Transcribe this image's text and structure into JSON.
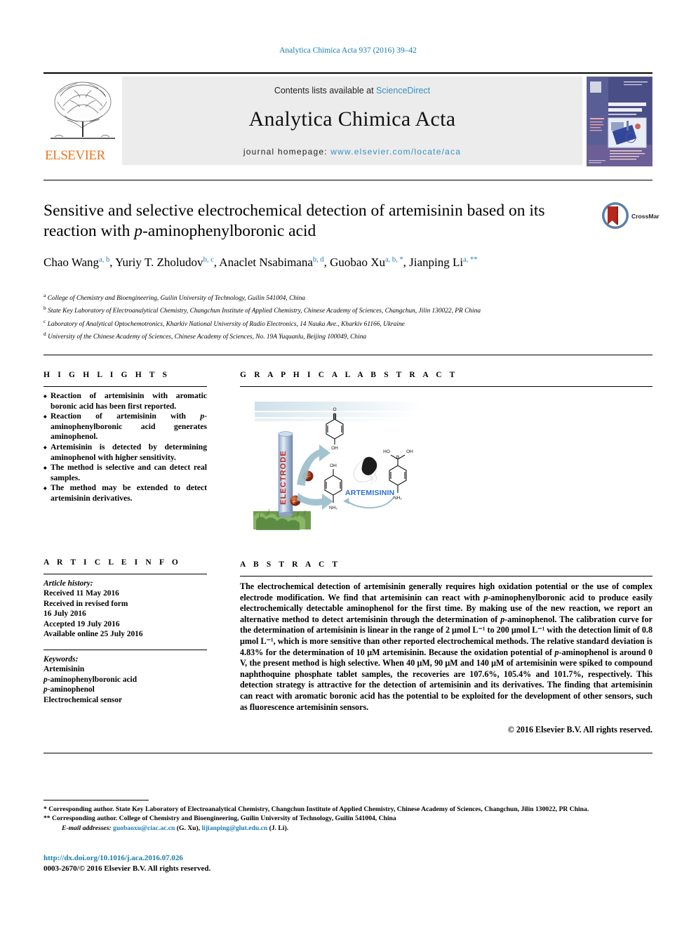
{
  "running_head": "Analytica Chimica Acta 937 (2016) 39–42",
  "masthead": {
    "contents_line_prefix": "Contents lists available at ",
    "sciencedirect": "ScienceDirect",
    "journal_title": "Analytica Chimica Acta",
    "homepage_label": "journal homepage: ",
    "homepage_url": "www.elsevier.com/locate/aca",
    "publisher": "ELSEVIER",
    "cover_title_line1": "ANALYTICA",
    "cover_title_line2": "CHIMICA ACTA"
  },
  "article": {
    "title_part1": "Sensitive and selective electrochemical detection of artemisinin based on its reaction with ",
    "title_italic": "p",
    "title_part2": "-aminophenylboronic acid",
    "crossmark_label": "CrossMark",
    "authors": [
      {
        "name": "Chao Wang",
        "sup": "a, b",
        "sep": ", "
      },
      {
        "name": "Yuriy T. Zholudov",
        "sup": "b, c",
        "sep": ", "
      },
      {
        "name": "Anaclet Nsabimana",
        "sup": "b, d",
        "sep": ", "
      },
      {
        "name": "Guobao Xu",
        "sup": "a, b, *",
        "sep": ", "
      },
      {
        "name": "Jianping Li",
        "sup": "a, **",
        "sep": ""
      }
    ],
    "affiliations": [
      {
        "mark": "a",
        "text": "College of Chemistry and Bioengineering, Guilin University of Technology, Guilin 541004, China"
      },
      {
        "mark": "b",
        "text": "State Key Laboratory of Electroanalytical Chemistry, Changchun Institute of Applied Chemistry, Chinese Academy of Sciences, Changchun, Jilin 130022, PR China"
      },
      {
        "mark": "c",
        "text": "Laboratory of Analytical Optochemotronics, Kharkiv National University of Radio Electronics, 14 Nauka Ave., Kharkiv 61166, Ukraine"
      },
      {
        "mark": "d",
        "text": "University of the Chinese Academy of Sciences, Chinese Academy of Sciences, No. 19A Yuquanlu, Beijing 100049, China"
      }
    ]
  },
  "highlights": {
    "heading": "H I G H L I G H T S",
    "items": [
      {
        "pre": "Reaction of artemisinin with aromatic boronic acid has been first reported."
      },
      {
        "pre": "Reaction of artemisinin with ",
        "ital": "p",
        "post": "-aminophenylboronic acid generates aminophenol."
      },
      {
        "pre": "Artemisinin is detected by determining aminophenol with higher sensitivity."
      },
      {
        "pre": "The method is selective and can detect real samples."
      },
      {
        "pre": "The method may be extended to detect artemisinin derivatives."
      }
    ]
  },
  "article_info": {
    "heading": "A R T I C L E  I N F O",
    "history_label": "Article history:",
    "history": [
      "Received 11 May 2016",
      "Received in revised form",
      "16 July 2016",
      "Accepted 19 July 2016",
      "Available online 25 July 2016"
    ],
    "keywords_label": "Keywords:",
    "keywords": [
      {
        "pre": "Artemisinin"
      },
      {
        "ital": "p",
        "post": "-aminophenylboronic acid"
      },
      {
        "ital": "p",
        "post": "-aminophenol"
      },
      {
        "pre": "Electrochemical sensor"
      }
    ]
  },
  "graphical_abstract": {
    "heading": "G R A P H I C A L  A B S T R A C T",
    "figure_labels": {
      "electrode": "ELECTRODE",
      "artemisinin": "ARTEMISININ",
      "oh": "OH",
      "nh2": "NH₂",
      "ho": "HO",
      "oh_right": "OH",
      "boron": "B",
      "oxygen": "O",
      "electron": "e⁻"
    }
  },
  "abstract": {
    "heading": "A B S T R A C T",
    "text_parts": [
      {
        "t": "The electrochemical detection of artemisinin generally requires high oxidation potential or the use of complex electrode modification. We find that artemisinin can react with "
      },
      {
        "t": "p",
        "i": true
      },
      {
        "t": "-aminophenylboronic acid to produce easily electrochemically detectable aminophenol for the first time. By making use of the new reaction, we report an alternative method to detect artemisinin through the determination of "
      },
      {
        "t": "p",
        "i": true
      },
      {
        "t": "-aminophenol. The calibration curve for the determination of artemisinin is linear in the range of 2 μmol L⁻¹ to 200 μmol L⁻¹ with the detection limit of 0.8 μmol L⁻¹, which is more sensitive than other reported electrochemical methods. The relative standard deviation is 4.83% for the determination of 10 μM artemisinin. Because the oxidation potential of "
      },
      {
        "t": "p",
        "i": true
      },
      {
        "t": "-aminophenol is around 0 V, the present method is high selective. When 40 μM, 90 μM and 140 μM of artemisinin were spiked to compound naphthoquine phosphate tablet samples, the recoveries are 107.6%, 105.4% and 101.7%, respectively. This detection strategy is attractive for the detection of artemisinin and its derivatives. The finding that artemisinin can react with aromatic boronic acid has the potential to be exploited for the development of other sensors, such as fluorescence artemisinin sensors."
      }
    ],
    "copyright": "© 2016 Elsevier B.V. All rights reserved."
  },
  "footnotes": {
    "corresponding_1": "* Corresponding author. State Key Laboratory of Electroanalytical Chemistry, Changchun Institute of Applied Chemistry, Chinese Academy of Sciences, Changchun, Jilin 130022, PR China.",
    "corresponding_2": "** Corresponding author. College of Chemistry and Bioengineering, Guilin University of Technology, Guilin 541004, China",
    "email_label": "E-mail addresses:",
    "email_1": "guobaoxu@ciac.ac.cn",
    "email_1_name": "(G. Xu),",
    "email_2": "lijianping@glut.edu.cn",
    "email_2_name": "(J. Li)."
  },
  "footer": {
    "doi": "http://dx.doi.org/10.1016/j.aca.2016.07.026",
    "issn_copyright": "0003-2670/© 2016 Elsevier B.V. All rights reserved."
  }
}
